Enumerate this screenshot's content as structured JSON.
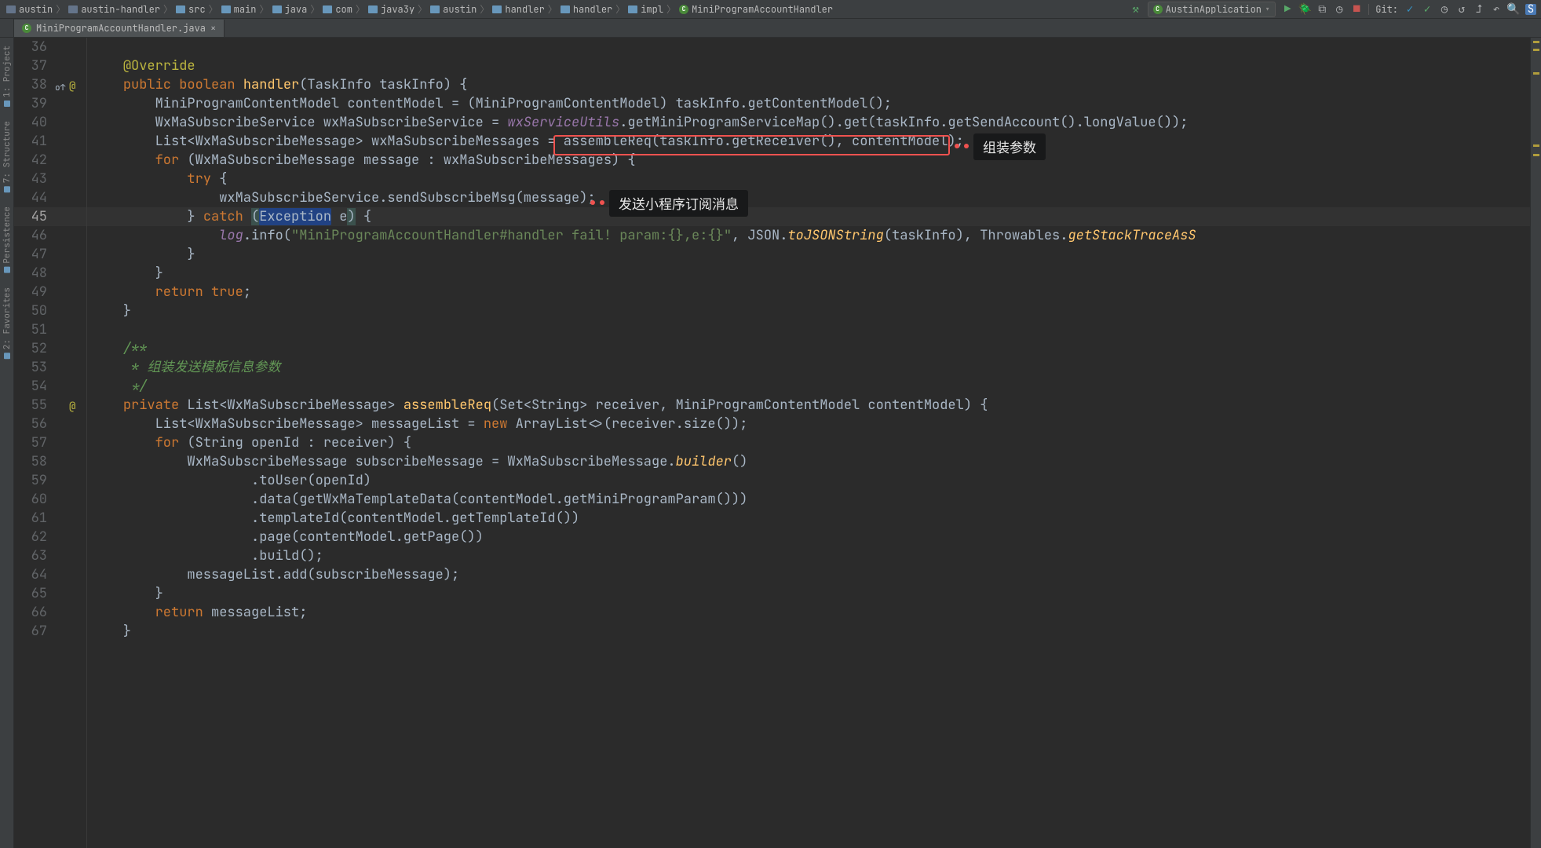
{
  "breadcrumbs": [
    {
      "icon": "mod",
      "label": "austin"
    },
    {
      "icon": "mod",
      "label": "austin-handler"
    },
    {
      "icon": "dir",
      "label": "src"
    },
    {
      "icon": "dir",
      "label": "main"
    },
    {
      "icon": "dir",
      "label": "java"
    },
    {
      "icon": "dir",
      "label": "com"
    },
    {
      "icon": "dir",
      "label": "java3y"
    },
    {
      "icon": "dir",
      "label": "austin"
    },
    {
      "icon": "dir",
      "label": "handler"
    },
    {
      "icon": "dir",
      "label": "handler"
    },
    {
      "icon": "dir",
      "label": "impl"
    },
    {
      "icon": "cls",
      "label": "MiniProgramAccountHandler"
    }
  ],
  "runConfig": "AustinApplication",
  "gitLabel": "Git:",
  "toolbarIcons": {
    "hammer": "⚒",
    "run": "▶",
    "debug": "🪲",
    "coverage": "⧉",
    "profile": "◷",
    "stop": "■",
    "gitUpdate": "✓",
    "gitCommit": "✓",
    "gitClock": "◷",
    "gitRevert": "↺",
    "gitPush": "⮥",
    "back": "↶",
    "search": "🔍",
    "settings": "⛭"
  },
  "tab": {
    "file": "MiniProgramAccountHandler.java",
    "close": "×"
  },
  "leftTabs": [
    "1: Project",
    "7: Structure",
    "Persistence",
    "2: Favorites"
  ],
  "callouts": {
    "assemble": "组装参数",
    "send": "发送小程序订阅消息"
  },
  "lines": [
    {
      "n": 36,
      "gut": "",
      "html": ""
    },
    {
      "n": 37,
      "gut": "",
      "html": "    <span class='ann'>@Override</span>"
    },
    {
      "n": 38,
      "gut": "ovr",
      "html": "    <span class='kw'>public</span> <span class='kw'>boolean</span> <span class='mth'>handler</span>(TaskInfo taskInfo) {"
    },
    {
      "n": 39,
      "gut": "",
      "html": "        MiniProgramContentModel contentModel = (MiniProgramContentModel) taskInfo.getContentModel();"
    },
    {
      "n": 40,
      "gut": "",
      "html": "        WxMaSubscribeService wxMaSubscribeService = <span class='stat'>wxServiceUtils</span>.getMiniProgramServiceMap().get(taskInfo.getSendAccount().longValue());"
    },
    {
      "n": 41,
      "gut": "",
      "html": "        List&lt;WxMaSubscribeMessage&gt; wxMaSubscribeMessages = assembleReq(taskInfo.getReceiver(), contentModel);"
    },
    {
      "n": 42,
      "gut": "",
      "html": "        <span class='kw'>for</span> (WxMaSubscribeMessage message : wxMaSubscribeMessages) {"
    },
    {
      "n": 43,
      "gut": "",
      "html": "            <span class='kw'>try</span> {"
    },
    {
      "n": 44,
      "gut": "",
      "html": "                wxMaSubscribeService.sendSubscribeMsg(message);"
    },
    {
      "n": 45,
      "gut": "",
      "cur": true,
      "html": "            } <span class='kw'>catch</span> <span class='hlParen'>(</span><span class='hl'>Exception</span> e<span class='hlParen'>)</span> {"
    },
    {
      "n": 46,
      "gut": "",
      "html": "                <span class='stat'>log</span>.info(<span class='str'>\"MiniProgramAccountHandler#handler fail! param:{},e:{}\"</span>, JSON.<span class='mthI'>toJSONString</span>(taskInfo), Throwables.<span class='mthI'>getStackTraceAsS</span>"
    },
    {
      "n": 47,
      "gut": "",
      "html": "            }"
    },
    {
      "n": 48,
      "gut": "",
      "html": "        }"
    },
    {
      "n": 49,
      "gut": "",
      "html": "        <span class='kw'>return</span> <span class='kw'>true</span>;"
    },
    {
      "n": 50,
      "gut": "",
      "html": "    }"
    },
    {
      "n": 51,
      "gut": "",
      "html": ""
    },
    {
      "n": 52,
      "gut": "",
      "html": "    <span class='cmtd'>/**</span>"
    },
    {
      "n": 53,
      "gut": "",
      "html": "<span class='cmtd'>     * 组装发送模板信息参数</span>"
    },
    {
      "n": 54,
      "gut": "",
      "html": "<span class='cmtd'>     */</span>"
    },
    {
      "n": 55,
      "gut": "at",
      "html": "    <span class='kw'>private</span> List&lt;WxMaSubscribeMessage&gt; <span class='mth'>assembleReq</span>(Set&lt;String&gt; receiver, MiniProgramContentModel contentModel) {"
    },
    {
      "n": 56,
      "gut": "",
      "html": "        List&lt;WxMaSubscribeMessage&gt; messageList = <span class='kw'>new</span> ArrayList&lt;&gt;(receiver.size());"
    },
    {
      "n": 57,
      "gut": "",
      "html": "        <span class='kw'>for</span> (String openId : receiver) {"
    },
    {
      "n": 58,
      "gut": "",
      "html": "            WxMaSubscribeMessage subscribeMessage = WxMaSubscribeMessage.<span class='mthI'>builder</span>()"
    },
    {
      "n": 59,
      "gut": "",
      "html": "                    .toUser(openId)"
    },
    {
      "n": 60,
      "gut": "",
      "html": "                    .data(getWxMaTemplateData(contentModel.getMiniProgramParam()))"
    },
    {
      "n": 61,
      "gut": "",
      "html": "                    .templateId(contentModel.getTemplateId())"
    },
    {
      "n": 62,
      "gut": "",
      "html": "                    .page(contentModel.getPage())"
    },
    {
      "n": 63,
      "gut": "",
      "html": "                    .build();"
    },
    {
      "n": 64,
      "gut": "",
      "html": "            messageList.add(subscribeMessage);"
    },
    {
      "n": 65,
      "gut": "",
      "html": "        }"
    },
    {
      "n": 66,
      "gut": "",
      "html": "        <span class='kw'>return</span> messageList;"
    },
    {
      "n": 67,
      "gut": "",
      "html": "    }"
    }
  ]
}
